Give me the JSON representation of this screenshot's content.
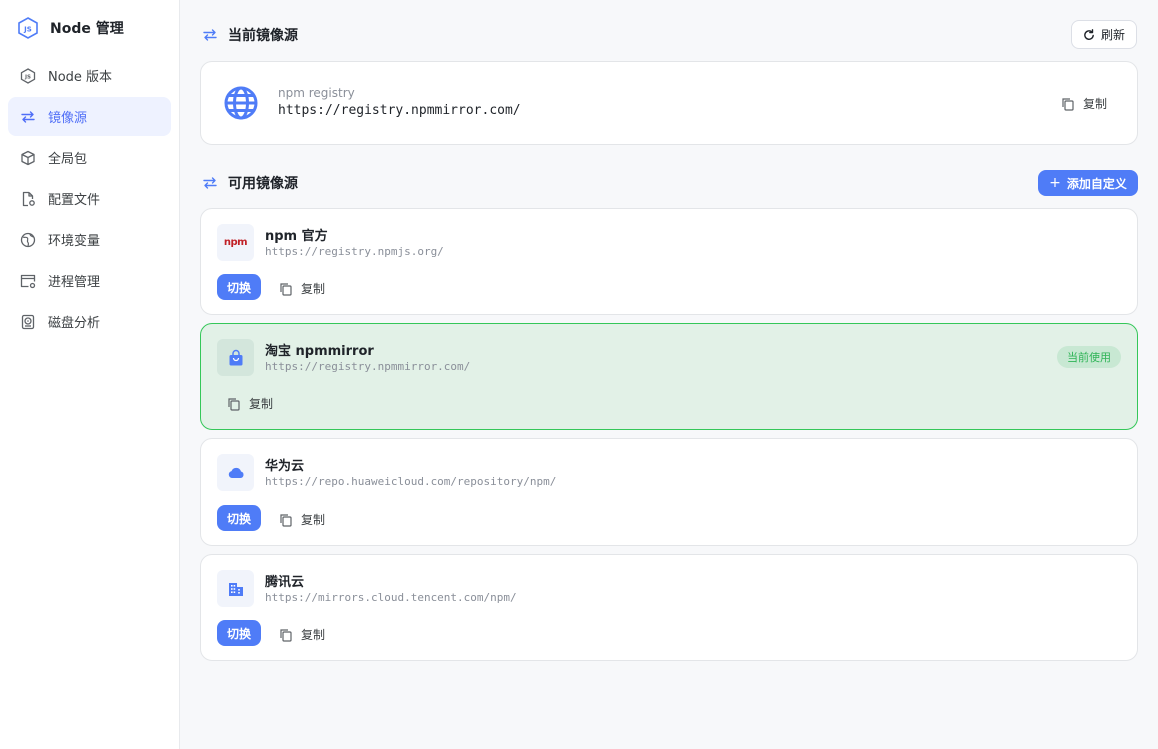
{
  "sidebar": {
    "brand": "Node 管理",
    "items": [
      {
        "label": "Node 版本",
        "icon": "nodejs-icon",
        "active": false
      },
      {
        "label": "镜像源",
        "icon": "swap-arrows-icon",
        "active": true
      },
      {
        "label": "全局包",
        "icon": "package-icon",
        "active": false
      },
      {
        "label": "配置文件",
        "icon": "file-gear-icon",
        "active": false
      },
      {
        "label": "环境变量",
        "icon": "globe-icon",
        "active": false
      },
      {
        "label": "进程管理",
        "icon": "window-gear-icon",
        "active": false
      },
      {
        "label": "磁盘分析",
        "icon": "disk-icon",
        "active": false
      }
    ]
  },
  "current": {
    "title": "当前镜像源",
    "refresh_label": "刷新",
    "label": "npm registry",
    "url": "https://registry.npmmirror.com/",
    "copy_label": "复制"
  },
  "available": {
    "title": "可用镜像源",
    "add_label": "添加自定义",
    "switch_label": "切换",
    "copy_label": "复制",
    "in_use_label": "当前使用",
    "mirrors": [
      {
        "name": "npm 官方",
        "url": "https://registry.npmjs.org/",
        "logo": "npm",
        "active": false
      },
      {
        "name": "淘宝 npmmirror",
        "url": "https://registry.npmmirror.com/",
        "logo": "shopping-bag-icon",
        "active": true
      },
      {
        "name": "华为云",
        "url": "https://repo.huaweicloud.com/repository/npm/",
        "logo": "cloud-icon",
        "active": false
      },
      {
        "name": "腾讯云",
        "url": "https://mirrors.cloud.tencent.com/npm/",
        "logo": "building-icon",
        "active": false
      }
    ]
  },
  "colors": {
    "accent": "#4f7cf7",
    "active_bg": "#e2f1e7",
    "active_border": "#34c759",
    "npm_red": "#c12127"
  }
}
